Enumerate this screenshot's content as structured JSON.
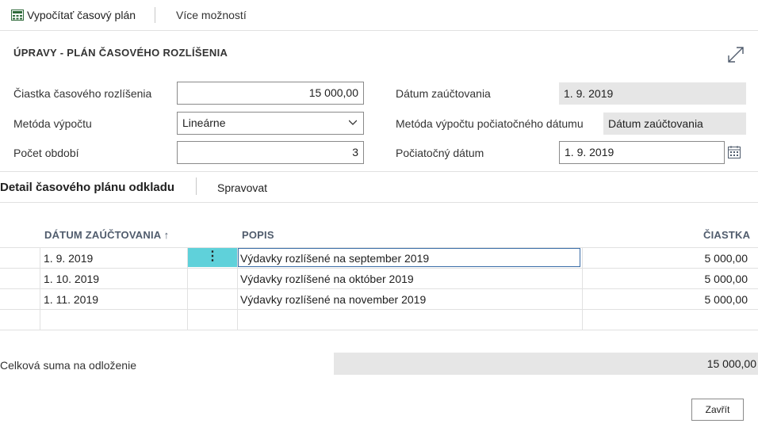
{
  "action_bar": {
    "calculate_label": "Vypočítať časový plán",
    "more_label": "Více možností"
  },
  "header": {
    "section_title": "ÚPRAVY - PLÁN ČASOVÉHO ROZLÍŠENIA",
    "amount_label": "Čiastka časového rozlíšenia",
    "amount_value": "15 000,00",
    "method_label": "Metóda výpočtu",
    "method_value": "Lineárne",
    "periods_label": "Počet období",
    "periods_value": "3",
    "posting_date_label": "Dátum zaúčtovania",
    "posting_date_value": "1. 9. 2019",
    "start_method_label": "Metóda výpočtu počiatočného dátumu",
    "start_method_value": "Dátum zaúčtovania",
    "start_date_label": "Počiatočný dátum",
    "start_date_value": "1. 9. 2019"
  },
  "lines": {
    "title": "Detail časového plánu odkladu",
    "manage_label": "Spravovat",
    "columns": {
      "date": "DÁTUM ZAÚČTOVANIA ↑",
      "description": "POPIS",
      "amount": "ČIASTKA"
    },
    "rows": [
      {
        "date": "1. 9. 2019",
        "description": "Výdavky rozlíšené na september 2019",
        "amount": "5 000,00"
      },
      {
        "date": "1. 10. 2019",
        "description": "Výdavky rozlíšené na október 2019",
        "amount": "5 000,00"
      },
      {
        "date": "1. 11. 2019",
        "description": "Výdavky rozlíšené na november 2019",
        "amount": "5 000,00"
      }
    ],
    "row_menu_glyph": "⋮"
  },
  "footer": {
    "total_label": "Celková suma na odloženie",
    "total_value": "15 000,00",
    "close_label": "Zavřít"
  },
  "colors": {
    "accent_selected": "#5fd1da",
    "active_border": "#3b6ea8",
    "readonly_bg": "#e6e6e6"
  }
}
